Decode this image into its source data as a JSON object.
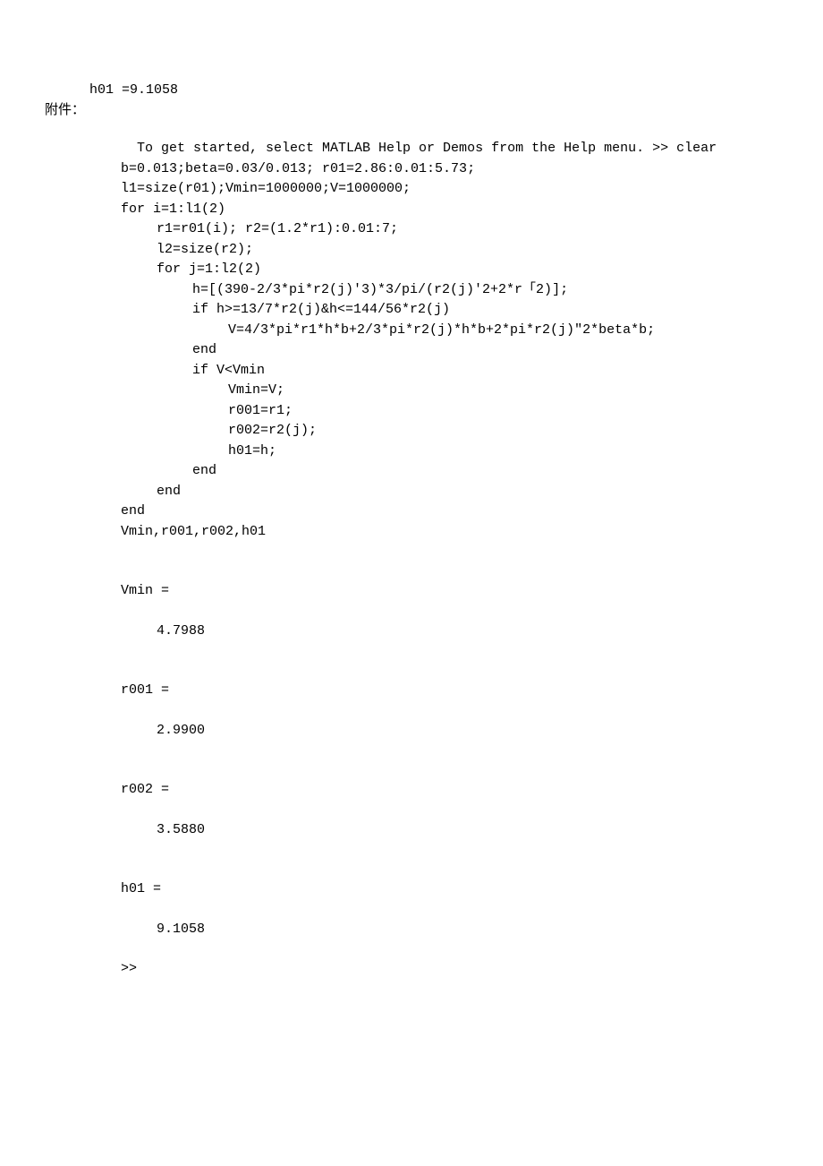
{
  "header": {
    "h01_result": "h01 =9.1058",
    "appendix_label": "附件："
  },
  "code": {
    "intro": "  To get started, select MATLAB Help or Demos from the Help menu. >> clear",
    "line1": "b=0.013;beta=0.03/0.013; r01=2.86:0.01:5.73;",
    "line2": "l1=size(r01);Vmin=1000000;V=1000000;",
    "line3": "for i=1:l1(2)",
    "line4": "r1=r01(i); r2=(1.2*r1):0.01:7;",
    "line5": "l2=size(r2);",
    "line6": "for j=1:l2(2)",
    "line7": "h=[(390-2/3*pi*r2(j)'3)*3/pi/(r2(j)'2+2*r「2)];",
    "line8": "if h>=13/7*r2(j)&h<=144/56*r2(j)",
    "line9": "V=4/3*pi*r1*h*b+2/3*pi*r2(j)*h*b+2*pi*r2(j)\"2*beta*b;",
    "line10": "end",
    "line11": "if V<Vmin",
    "line12": "Vmin=V;",
    "line13": "r001=r1;",
    "line14": "r002=r2(j);",
    "line15": "h01=h;",
    "line16": "end",
    "line17": "end",
    "line18": "end",
    "line19": "Vmin,r001,r002,h01"
  },
  "output": {
    "vmin_label": "Vmin =",
    "vmin_value": "4.7988",
    "r001_label": "r001 =",
    "r001_value": "2.9900",
    "r002_label": "r002 =",
    "r002_value": "3.5880",
    "h01_label": "h01 =",
    "h01_value": "9.1058",
    "prompt": ">>"
  }
}
